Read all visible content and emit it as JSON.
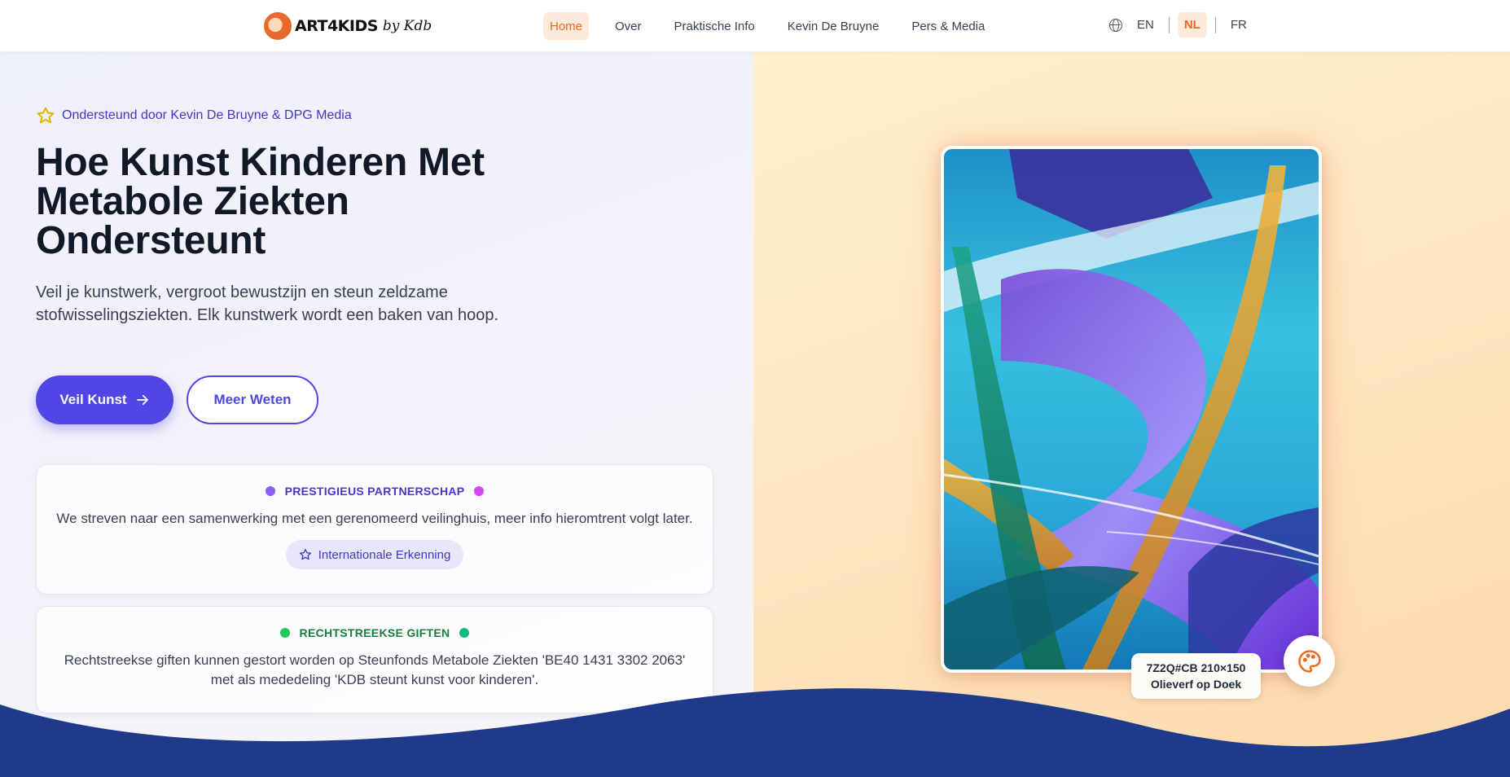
{
  "header": {
    "logo_text": "ART4KIDS",
    "logo_sub": "by Kdb",
    "nav": [
      "Home",
      "Over",
      "Praktische Info",
      "Kevin De Bruyne",
      "Pers & Media"
    ],
    "active_nav": "Home",
    "languages": [
      "EN",
      "NL",
      "FR"
    ],
    "active_language": "NL"
  },
  "hero": {
    "support_text": "Ondersteund door Kevin De Bruyne & DPG Media",
    "title": "Hoe Kunst Kinderen Met Metabole Ziekten Ondersteunt",
    "subtitle": "Veil je kunstwerk, vergroot bewustzijn en steun zeldzame stofwisselingsziekten. Elk kunstwerk wordt een baken van hoop.",
    "primary_button": "Veil Kunst",
    "secondary_button": "Meer Weten"
  },
  "cards": [
    {
      "heading": "PRESTIGIEUS PARTNERSCHAP",
      "text": "We streven naar een samenwerking met een gerenomeerd veilinghuis, meer info hieromtrent volgt later.",
      "chip": "Internationale Erkenning",
      "heading_color": "#4338ca",
      "dot_colors": [
        "#8b5cf6",
        "#d946ef"
      ]
    },
    {
      "heading": "RECHTSTREEKSE GIFTEN",
      "text": "Rechtstreekse giften kunnen gestort worden op Steunfonds Metabole Ziekten 'BE40 1431 3302 2063' met als mededeling 'KDB steunt kunst voor kinderen'.",
      "heading_color": "#15803d",
      "dot_colors": [
        "#22c55e",
        "#10b981"
      ]
    }
  ],
  "artwork": {
    "caption_line1": "7Z2Q#CB 210×150",
    "caption_line2": "Olieverf op Doek"
  },
  "colors": {
    "primary": "#4f46e5",
    "accent": "#ea6a1c",
    "wave": "#1e3a8a"
  },
  "icons": {
    "support": "star-icon",
    "primary_button": "arrow-right-icon",
    "chip": "star-outline-icon",
    "language": "globe-icon",
    "artwork_button": "palette-icon"
  }
}
